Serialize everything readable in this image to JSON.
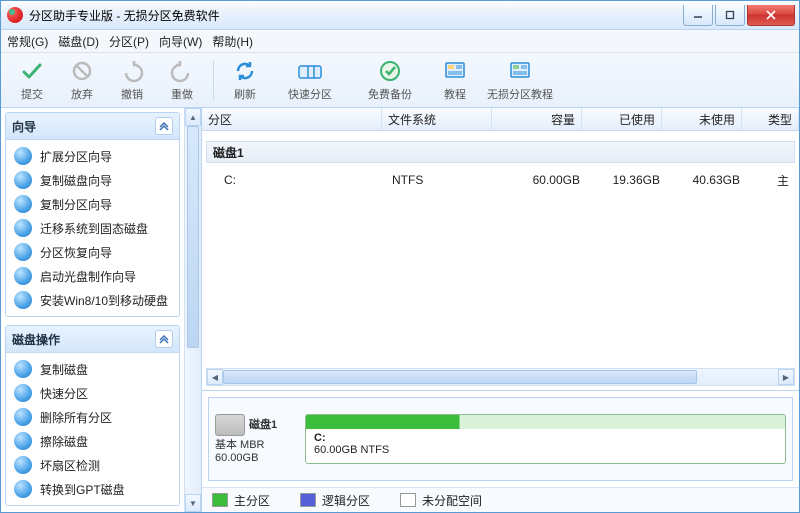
{
  "window": {
    "title": "分区助手专业版 - 无损分区免费软件"
  },
  "menu": {
    "general": "常规(G)",
    "disk": "磁盘(D)",
    "partition": "分区(P)",
    "wizard": "向导(W)",
    "help": "帮助(H)"
  },
  "toolbar": {
    "commit": "提交",
    "discard": "放弃",
    "undo": "撤销",
    "redo": "重做",
    "refresh": "刷新",
    "quick_part": "快速分区",
    "free_backup": "免费备份",
    "tutorial": "教程",
    "lossless_tutorial": "无损分区教程"
  },
  "sidebar": {
    "wizard_title": "向导",
    "wizard_items": [
      "扩展分区向导",
      "复制磁盘向导",
      "复制分区向导",
      "迁移系统到固态磁盘",
      "分区恢复向导",
      "启动光盘制作向导",
      "安装Win8/10到移动硬盘"
    ],
    "diskops_title": "磁盘操作",
    "diskops_items": [
      "复制磁盘",
      "快速分区",
      "删除所有分区",
      "擦除磁盘",
      "坏扇区检测",
      "转换到GPT磁盘"
    ]
  },
  "grid": {
    "headers": {
      "partition": "分区",
      "fs": "文件系统",
      "capacity": "容量",
      "used": "已使用",
      "unused": "未使用",
      "type": "类型"
    },
    "group": "磁盘1",
    "row": {
      "name": "C:",
      "fs": "NTFS",
      "capacity": "60.00GB",
      "used": "19.36GB",
      "unused": "40.63GB",
      "type": "主"
    }
  },
  "diskmap": {
    "disk_name": "磁盘1",
    "disk_type": "基本 MBR",
    "disk_size": "60.00GB",
    "part_label": "C:",
    "part_detail": "60.00GB NTFS"
  },
  "legend": {
    "primary": "主分区",
    "logical": "逻辑分区",
    "unalloc": "未分配空间"
  }
}
